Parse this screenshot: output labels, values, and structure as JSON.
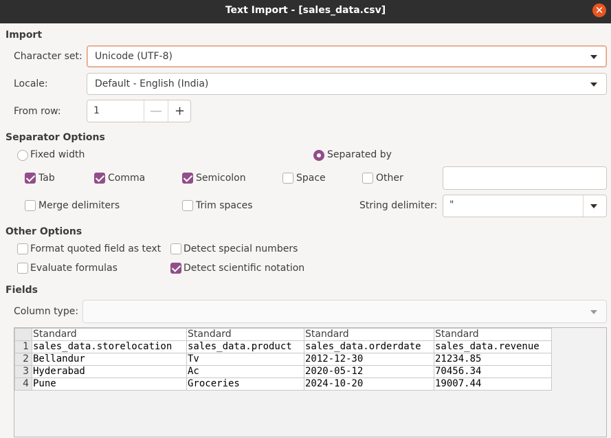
{
  "window": {
    "title": "Text Import - [sales_data.csv]",
    "close_glyph": "✕"
  },
  "import": {
    "heading": "Import",
    "charset_label": "Character set:",
    "charset_value": "Unicode (UTF-8)",
    "locale_label": "Locale:",
    "locale_value": "Default - English (India)",
    "from_row_label": "From row:",
    "from_row_value": "1",
    "minus_glyph": "—",
    "plus_glyph": "+"
  },
  "separator": {
    "heading": "Separator Options",
    "fixed_width": "Fixed width",
    "separated_by": "Separated by",
    "tab": "Tab",
    "comma": "Comma",
    "semicolon": "Semicolon",
    "space": "Space",
    "other": "Other",
    "merge_delimiters": "Merge delimiters",
    "trim_spaces": "Trim spaces",
    "string_delimiter_label": "String delimiter:",
    "string_delimiter_value": "\""
  },
  "other_options": {
    "heading": "Other Options",
    "format_quoted": "Format quoted field as text",
    "detect_special": "Detect special numbers",
    "evaluate_formulas": "Evaluate formulas",
    "detect_scientific": "Detect scientific notation"
  },
  "fields": {
    "heading": "Fields",
    "column_type_label": "Column type:",
    "column_type_value": "",
    "column_headers": [
      "Standard",
      "Standard",
      "Standard",
      "Standard"
    ],
    "rows": [
      {
        "num": "1",
        "cells": [
          "sales_data.storelocation",
          "sales_data.product",
          "sales_data.orderdate",
          "sales_data.revenue"
        ]
      },
      {
        "num": "2",
        "cells": [
          "Bellandur",
          "Tv",
          "2012-12-30",
          "21234.85"
        ]
      },
      {
        "num": "3",
        "cells": [
          "Hyderabad",
          "Ac",
          "2020-05-12",
          "70456.34"
        ]
      },
      {
        "num": "4",
        "cells": [
          "Pune",
          "Groceries",
          "2024-10-20",
          "19007.44"
        ]
      }
    ]
  },
  "colors": {
    "accent": "#924d8b",
    "focus_border": "#e19d80",
    "close": "#e95420"
  }
}
